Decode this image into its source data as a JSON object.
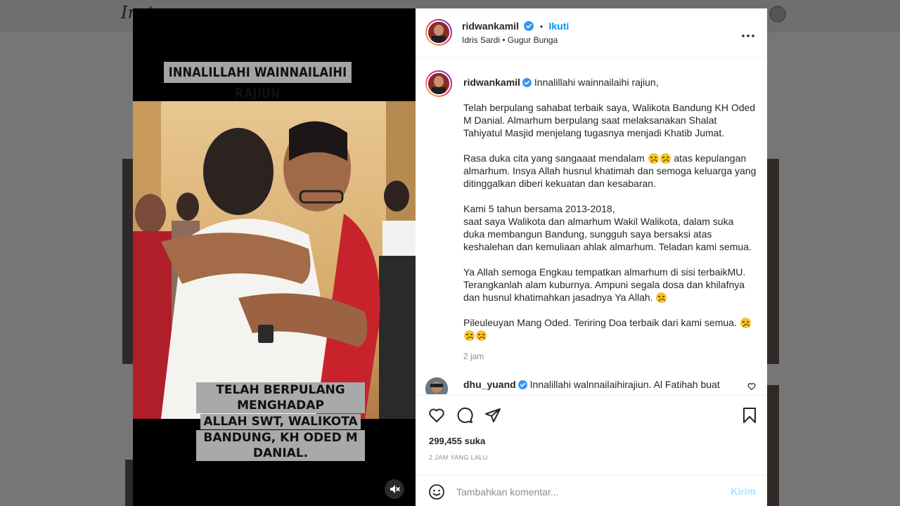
{
  "background": {
    "logo": "Inst"
  },
  "media": {
    "title_overlay": "INNALILLAHI WAINNAILAIHI RAJIUN",
    "caption_overlay": [
      "TELAH BERPULANG MENGHADAP",
      "ALLAH SWT, WALIKOTA",
      "BANDUNG, KH ODED M DANIAL."
    ],
    "mute_icon": "speaker-muted-icon"
  },
  "header": {
    "username": "ridwankamil",
    "follow_label": "Ikuti",
    "dot": "•",
    "audio": "Idris Sardi • Gugur Bunga",
    "more_label": "•••"
  },
  "caption": {
    "username": "ridwankamil",
    "first_line": "Innalillahi wainnailaihi rajiun,",
    "p1": "Telah berpulang sahabat terbaik saya, Walikota Bandung KH Oded M Danial. Almarhum berpulang saat melaksanakan Shalat Tahiyatul Masjid menjelang tugasnya menjadi Khatib Jumat.",
    "p2_a": "Rasa duka cita yang sangaaat mendalam",
    "p2_b": "atas kepulangan almarhum. Insya Allah husnul khatimah dan semoga keluarga yang ditinggalkan diberi kekuatan dan kesabaran.",
    "p3_l1": "Kami 5 tahun bersama 2013-2018,",
    "p3_l2": "saat saya Walikota dan almarhum Wakil Walikota, dalam suka duka membangun Bandung, sungguh saya bersaksi atas keshalehan dan kemuliaan ahlak almarhum. Teladan kami semua.",
    "p4": "Ya Allah semoga Engkau tempatkan almarhum di sisi terbaikMU. Terangkanlah alam kuburnya. Ampuni segala dosa dan khilafnya dan husnul khatimahkan jasadnya Ya Allah.",
    "p5": "Pileuleuyan Mang Oded. Teriring Doa terbaik dari kami semua.",
    "time": "2 jam"
  },
  "comment": {
    "username": "dhu_yuand",
    "text": "Innalillahi walnnailaihirajiun. Al Fatihah buat"
  },
  "stats": {
    "likes": "299,455 suka",
    "posted": "2 JAM YANG LALU"
  },
  "add_comment": {
    "placeholder": "Tambahkan komentar...",
    "post_label": "Kirim"
  },
  "colors": {
    "accent": "#0095f6",
    "verified": "#3897f0",
    "post_disabled": "#b2dffc"
  }
}
